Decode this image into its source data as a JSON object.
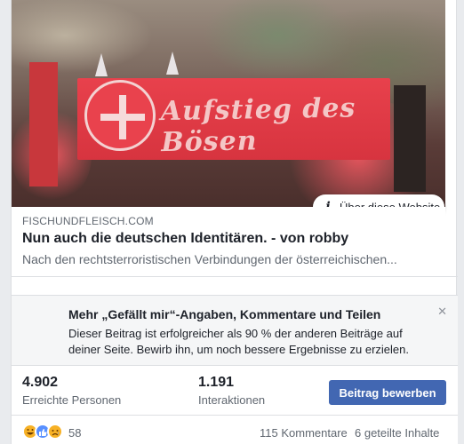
{
  "preview": {
    "banner_text": "Aufstieg des Bösen",
    "about_label": "Über diese Website"
  },
  "link": {
    "domain": "FISCHUNDFLEISCH.COM",
    "headline": "Nun auch die deutschen Identitären. - von robby",
    "description": "Nach den rechtsterroristischen Verbindungen der österreichischen..."
  },
  "promo": {
    "title": "Mehr „Gefällt mir“-Angaben, Kommentare und Teilen",
    "body": "Dieser Beitrag ist erfolgreicher als 90 % der anderen Beiträge auf deiner Seite. Bewirb ihn, um noch bessere Ergebnisse zu erzielen.",
    "close_glyph": "✕"
  },
  "stats": {
    "reach_value": "4.902",
    "reach_label": "Erreichte Personen",
    "interactions_value": "1.191",
    "interactions_label": "Interaktionen",
    "boost_label": "Beitrag bewerben"
  },
  "engagement": {
    "reaction_icons": [
      "haha-icon",
      "like-icon",
      "sad-icon"
    ],
    "reaction_count": "58",
    "comments": "115 Kommentare",
    "shares": "6 geteilte Inhalte"
  },
  "colors": {
    "accent": "#4267b2",
    "banner": "#d7343f",
    "muted_text": "#606770"
  }
}
